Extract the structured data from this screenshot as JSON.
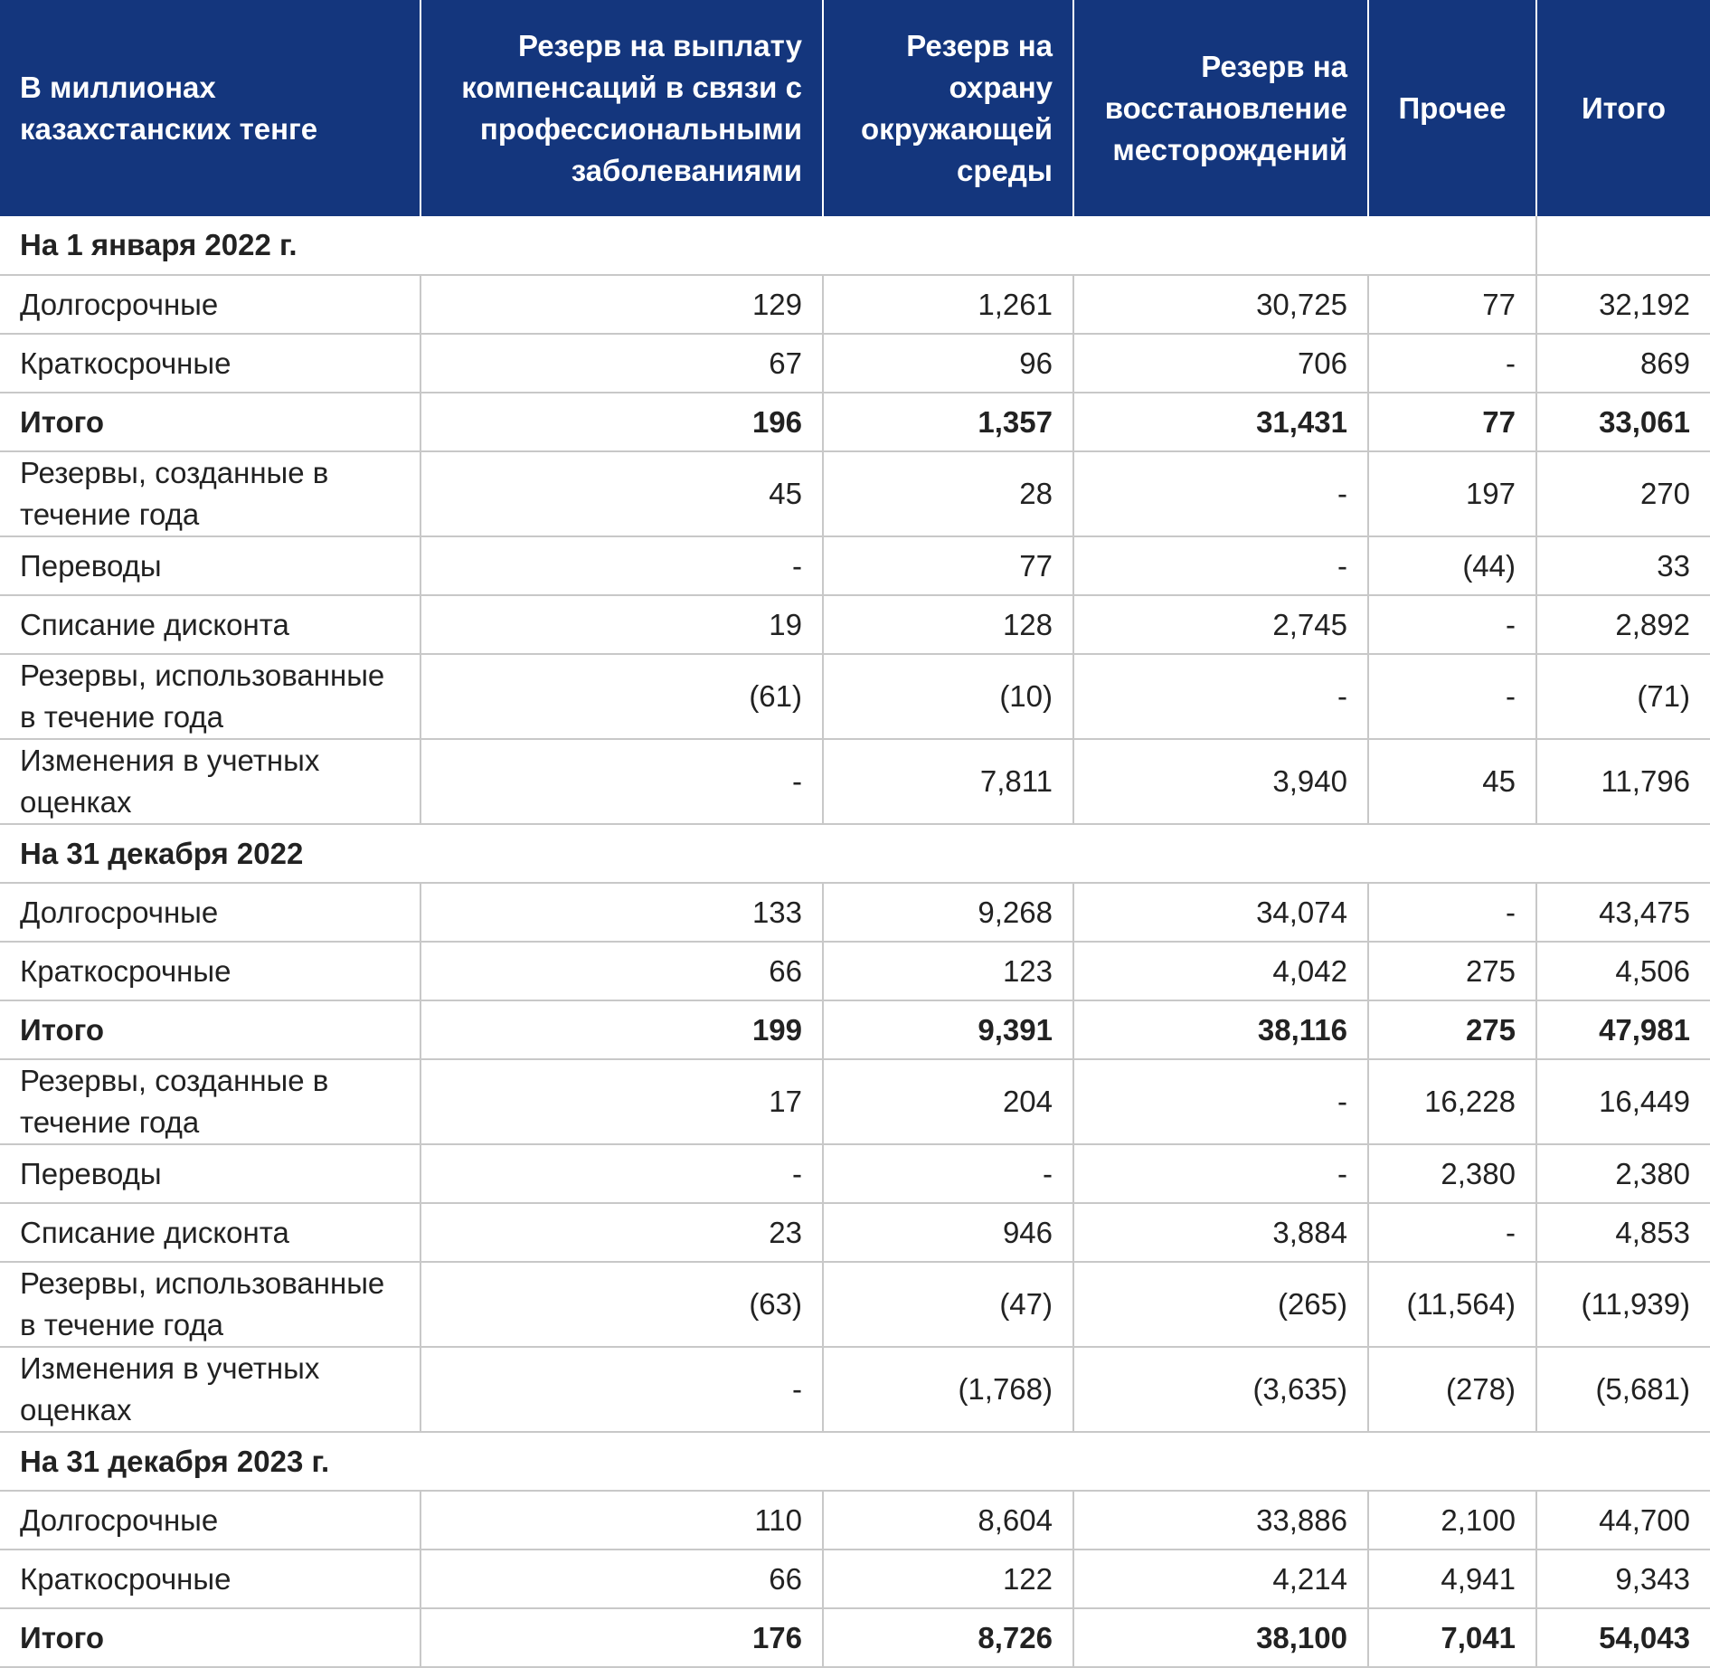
{
  "header": {
    "col0": "В миллионах казахстанских тенге",
    "col1": "Резерв на выплату компенсаций в связи с профессиональными заболеваниями",
    "col2": "Резерв на охрану окружающей среды",
    "col3": "Резерв на восстановление месторождений",
    "col4": "Прочее",
    "col5": "Итого"
  },
  "sections": [
    {
      "title": "На 1 января 2022 г.",
      "rows": [
        {
          "label": "Долгосрочные",
          "values": [
            "129",
            "1,261",
            "30,725",
            "77",
            "32,192"
          ]
        },
        {
          "label": "Краткосрочные",
          "values": [
            "67",
            "96",
            "706",
            "-",
            "869"
          ]
        },
        {
          "label": "Итого",
          "values": [
            "196",
            "1,357",
            "31,431",
            "77",
            "33,061"
          ]
        },
        {
          "label": "Резервы, созданные в течение года",
          "values": [
            "45",
            "28",
            "-",
            "197",
            "270"
          ]
        },
        {
          "label": "Переводы",
          "values": [
            "-",
            "77",
            "-",
            "(44)",
            "33"
          ]
        },
        {
          "label": "Списание дисконта",
          "values": [
            "19",
            "128",
            "2,745",
            "-",
            "2,892"
          ]
        },
        {
          "label": "Резервы, использованные в течение года",
          "values": [
            "(61)",
            "(10)",
            "-",
            "-",
            "(71)"
          ]
        },
        {
          "label": "Изменения в учетных оценках",
          "values": [
            "-",
            "7,811",
            "3,940",
            "45",
            "11,796"
          ]
        }
      ]
    },
    {
      "title": "На 31 декабря 2022",
      "rows": [
        {
          "label": "Долгосрочные",
          "values": [
            "133",
            "9,268",
            "34,074",
            "-",
            "43,475"
          ]
        },
        {
          "label": "Краткосрочные",
          "values": [
            "66",
            "123",
            "4,042",
            "275",
            "4,506"
          ]
        },
        {
          "label": "Итого",
          "values": [
            "199",
            "9,391",
            "38,116",
            "275",
            "47,981"
          ]
        },
        {
          "label": "Резервы, созданные в течение года",
          "values": [
            "17",
            "204",
            "-",
            "16,228",
            "16,449"
          ]
        },
        {
          "label": "Переводы",
          "values": [
            "-",
            "-",
            "-",
            "2,380",
            "2,380"
          ]
        },
        {
          "label": "Списание дисконта",
          "values": [
            "23",
            "946",
            "3,884",
            "-",
            "4,853"
          ]
        },
        {
          "label": "Резервы, использованные в течение года",
          "values": [
            "(63)",
            "(47)",
            "(265)",
            "(11,564)",
            "(11,939)"
          ]
        },
        {
          "label": "Изменения в учетных оценках",
          "values": [
            "-",
            "(1,768)",
            "(3,635)",
            "(278)",
            "(5,681)"
          ]
        }
      ]
    },
    {
      "title": "На 31 декабря 2023 г.",
      "rows": [
        {
          "label": "Долгосрочные",
          "values": [
            "110",
            "8,604",
            "33,886",
            "2,100",
            "44,700"
          ]
        },
        {
          "label": "Краткосрочные",
          "values": [
            "66",
            "122",
            "4,214",
            "4,941",
            "9,343"
          ]
        },
        {
          "label": "Итого",
          "values": [
            "176",
            "8,726",
            "38,100",
            "7,041",
            "54,043"
          ]
        }
      ]
    }
  ],
  "colors": {
    "header_bg": "#14367d",
    "header_text": "#ffffff",
    "grid": "#c8c8c8",
    "text": "#222222"
  }
}
